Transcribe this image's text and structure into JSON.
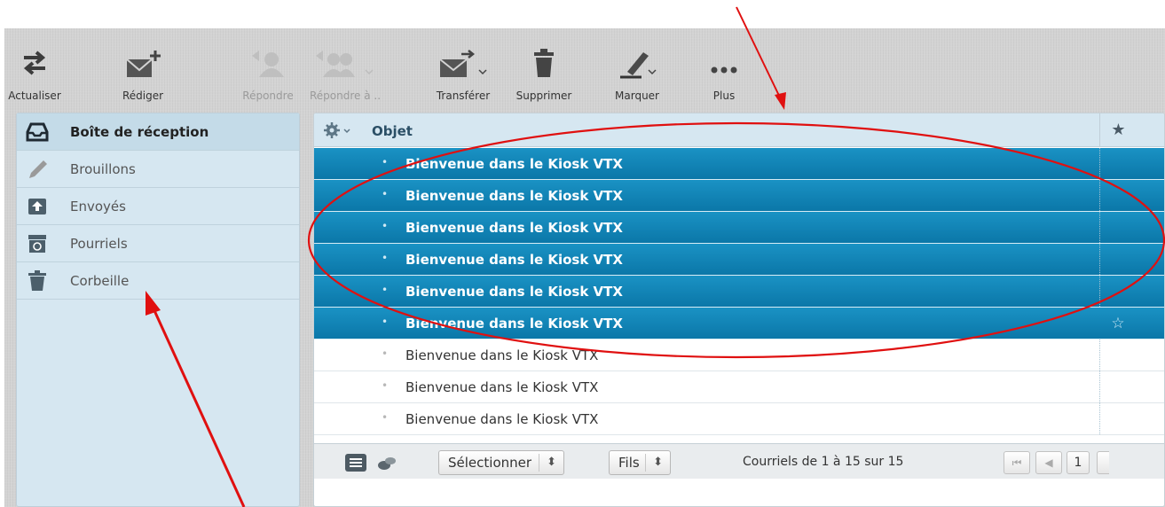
{
  "toolbar": {
    "buttons": [
      {
        "label": "Actualiser",
        "icon": "refresh-arrows-icon",
        "enabled": true
      },
      {
        "label": "Rédiger",
        "icon": "compose-envelope-icon",
        "enabled": true
      },
      {
        "label": "Répondre",
        "icon": "reply-icon",
        "enabled": false
      },
      {
        "label": "Répondre à ..",
        "icon": "reply-all-icon",
        "enabled": false
      },
      {
        "label": "Transférer",
        "icon": "forward-envelope-icon",
        "enabled": true
      },
      {
        "label": "Supprimer",
        "icon": "trash-icon",
        "enabled": true
      },
      {
        "label": "Marquer",
        "icon": "mark-pen-icon",
        "enabled": true
      },
      {
        "label": "Plus",
        "icon": "more-dots-icon",
        "enabled": true
      }
    ]
  },
  "folders": [
    {
      "label": "Boîte de réception",
      "icon": "inbox-tray-icon",
      "active": true
    },
    {
      "label": "Brouillons",
      "icon": "pencil-icon",
      "active": false
    },
    {
      "label": "Envoyés",
      "icon": "sent-tray-icon",
      "active": false
    },
    {
      "label": "Pourriels",
      "icon": "junk-bin-icon",
      "active": false
    },
    {
      "label": "Corbeille",
      "icon": "trash-icon",
      "active": false
    }
  ],
  "list": {
    "header_subject": "Objet",
    "header_star": "★",
    "rows": [
      {
        "subject": "Bienvenue dans le Kiosk VTX",
        "selected": true
      },
      {
        "subject": "Bienvenue dans le Kiosk VTX",
        "selected": true
      },
      {
        "subject": "Bienvenue dans le Kiosk VTX",
        "selected": true
      },
      {
        "subject": "Bienvenue dans le Kiosk VTX",
        "selected": true
      },
      {
        "subject": "Bienvenue dans le Kiosk VTX",
        "selected": true
      },
      {
        "subject": "Bienvenue dans le Kiosk VTX",
        "selected": true,
        "star": "☆"
      },
      {
        "subject": "Bienvenue dans le Kiosk VTX",
        "selected": false
      },
      {
        "subject": "Bienvenue dans le Kiosk VTX",
        "selected": false
      },
      {
        "subject": "Bienvenue dans le Kiosk VTX",
        "selected": false
      }
    ],
    "row_bullet": "•"
  },
  "footer": {
    "select_label": "Sélectionner",
    "threads_label": "Fils",
    "select_arrow": "⬍",
    "count_text": "Courriels de 1 à 15 sur 15",
    "first_page": "⏮",
    "prev_page": "◀",
    "page_number": "1"
  },
  "colors": {
    "selection_blue": "#0b86b8",
    "sidebar_bg": "#d6e7f1",
    "annotation_red": "#e01010"
  }
}
